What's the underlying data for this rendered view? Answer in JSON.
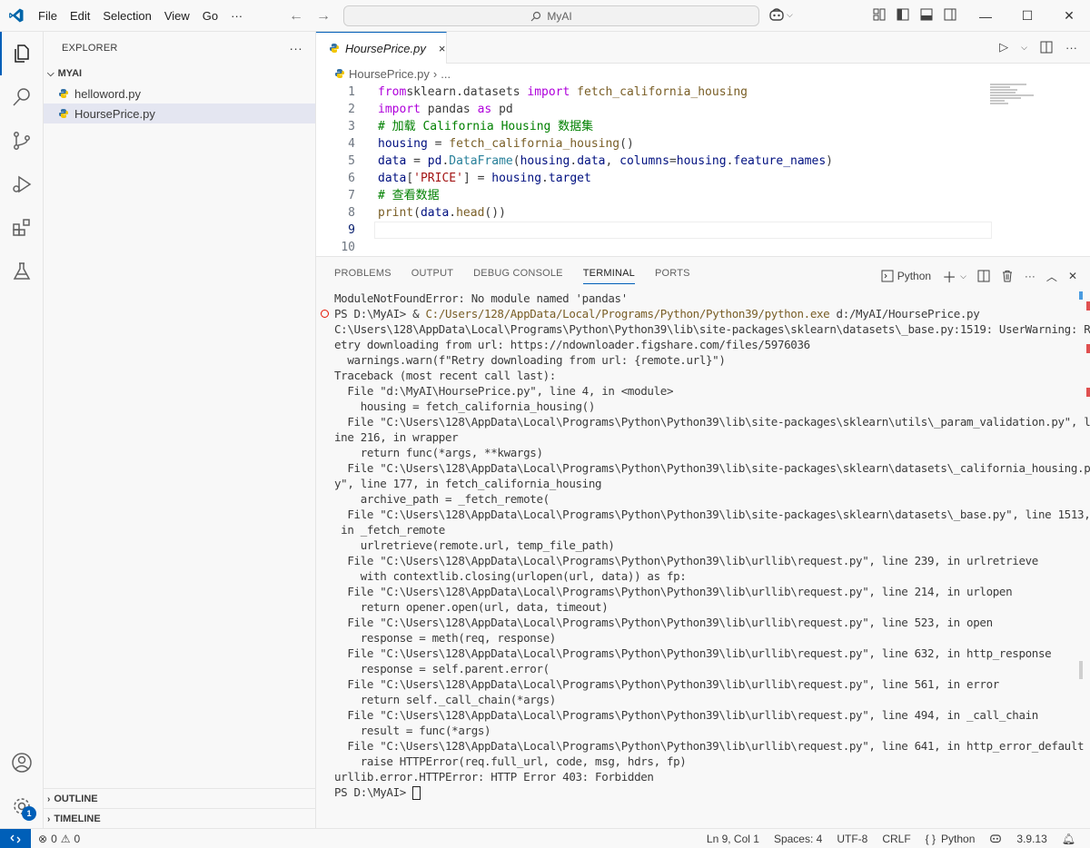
{
  "titlebar": {
    "menus": [
      "File",
      "Edit",
      "Selection",
      "View",
      "Go",
      "···"
    ],
    "search": "MyAI"
  },
  "sidebar": {
    "title": "EXPLORER",
    "more": "···",
    "folder": "MYAI",
    "files": [
      {
        "name": "helloword.py",
        "selected": false
      },
      {
        "name": "HoursePrice.py",
        "selected": true
      }
    ],
    "outline": "OUTLINE",
    "timeline": "TIMELINE"
  },
  "tabs": [
    {
      "label": "HoursePrice.py",
      "close": "×"
    }
  ],
  "breadcrumb": {
    "file": "HoursePrice.py",
    "rest": "..."
  },
  "editor": {
    "current_line": 9,
    "lines": [
      {
        "n": "1",
        "segments": [
          [
            "kw",
            "from"
          ],
          [
            "",
            "sklearn.datasets "
          ],
          [
            "kw",
            "import"
          ],
          [
            "",
            " "
          ],
          [
            "fn",
            "fetch_california_housing"
          ]
        ]
      },
      {
        "n": "2",
        "segments": [
          [
            "kw",
            "import"
          ],
          [
            "",
            " pandas "
          ],
          [
            "kw",
            "as"
          ],
          [
            "",
            " pd"
          ]
        ]
      },
      {
        "n": "3",
        "segments": [
          [
            "cmt",
            "# 加载 California Housing 数据集"
          ]
        ]
      },
      {
        "n": "4",
        "segments": [
          [
            "var",
            "housing"
          ],
          [
            "",
            " = "
          ],
          [
            "fn",
            "fetch_california_housing"
          ],
          [
            "",
            "()"
          ]
        ]
      },
      {
        "n": "5",
        "segments": [
          [
            "var",
            "data"
          ],
          [
            "",
            " = "
          ],
          [
            "var",
            "pd"
          ],
          [
            "",
            "."
          ],
          [
            "cls",
            "DataFrame"
          ],
          [
            "",
            "("
          ],
          [
            "var",
            "housing"
          ],
          [
            "",
            "."
          ],
          [
            "var",
            "data"
          ],
          [
            "",
            ", "
          ],
          [
            "var",
            "columns"
          ],
          [
            "",
            "="
          ],
          [
            "var",
            "housing"
          ],
          [
            "",
            "."
          ],
          [
            "var",
            "feature_names"
          ],
          [
            "",
            ")"
          ]
        ]
      },
      {
        "n": "6",
        "segments": [
          [
            "var",
            "data"
          ],
          [
            "",
            "["
          ],
          [
            "str",
            "'PRICE'"
          ],
          [
            "",
            "] = "
          ],
          [
            "var",
            "housing"
          ],
          [
            "",
            "."
          ],
          [
            "var",
            "target"
          ]
        ]
      },
      {
        "n": "7",
        "segments": [
          [
            "cmt",
            "# 查看数据"
          ]
        ]
      },
      {
        "n": "8",
        "segments": [
          [
            "fn",
            "print"
          ],
          [
            "",
            "("
          ],
          [
            "var",
            "data"
          ],
          [
            "",
            "."
          ],
          [
            "fn",
            "head"
          ],
          [
            "",
            "())"
          ]
        ]
      },
      {
        "n": "9",
        "segments": []
      },
      {
        "n": "10",
        "segments": []
      }
    ]
  },
  "panel": {
    "tabs": [
      "PROBLEMS",
      "OUTPUT",
      "DEBUG CONSOLE",
      "TERMINAL",
      "PORTS"
    ],
    "active_tab": "TERMINAL",
    "shell_label": "Python",
    "terminal": {
      "first": "ModuleNotFoundError: No module named 'pandas'",
      "prompt_cmd": "PS D:\\MyAI> & ",
      "exe": "C:/Users/128/AppData/Local/Programs/Python/Python39/python.exe",
      "arg": " d:/MyAI/HoursePrice.py",
      "lines": [
        "C:\\Users\\128\\AppData\\Local\\Programs\\Python\\Python39\\lib\\site-packages\\sklearn\\datasets\\_base.py:1519: UserWarning: R",
        "etry downloading from url: https://ndownloader.figshare.com/files/5976036",
        "  warnings.warn(f\"Retry downloading from url: {remote.url}\")",
        "Traceback (most recent call last):",
        "  File \"d:\\MyAI\\HoursePrice.py\", line 4, in <module>",
        "    housing = fetch_california_housing()",
        "  File \"C:\\Users\\128\\AppData\\Local\\Programs\\Python\\Python39\\lib\\site-packages\\sklearn\\utils\\_param_validation.py\", l",
        "ine 216, in wrapper",
        "    return func(*args, **kwargs)",
        "  File \"C:\\Users\\128\\AppData\\Local\\Programs\\Python\\Python39\\lib\\site-packages\\sklearn\\datasets\\_california_housing.p",
        "y\", line 177, in fetch_california_housing",
        "    archive_path = _fetch_remote(",
        "  File \"C:\\Users\\128\\AppData\\Local\\Programs\\Python\\Python39\\lib\\site-packages\\sklearn\\datasets\\_base.py\", line 1513,",
        " in _fetch_remote",
        "    urlretrieve(remote.url, temp_file_path)",
        "  File \"C:\\Users\\128\\AppData\\Local\\Programs\\Python\\Python39\\lib\\urllib\\request.py\", line 239, in urlretrieve",
        "    with contextlib.closing(urlopen(url, data)) as fp:",
        "  File \"C:\\Users\\128\\AppData\\Local\\Programs\\Python\\Python39\\lib\\urllib\\request.py\", line 214, in urlopen",
        "    return opener.open(url, data, timeout)",
        "  File \"C:\\Users\\128\\AppData\\Local\\Programs\\Python\\Python39\\lib\\urllib\\request.py\", line 523, in open",
        "    response = meth(req, response)",
        "  File \"C:\\Users\\128\\AppData\\Local\\Programs\\Python\\Python39\\lib\\urllib\\request.py\", line 632, in http_response",
        "    response = self.parent.error(",
        "  File \"C:\\Users\\128\\AppData\\Local\\Programs\\Python\\Python39\\lib\\urllib\\request.py\", line 561, in error",
        "    return self._call_chain(*args)",
        "  File \"C:\\Users\\128\\AppData\\Local\\Programs\\Python\\Python39\\lib\\urllib\\request.py\", line 494, in _call_chain",
        "    result = func(*args)",
        "  File \"C:\\Users\\128\\AppData\\Local\\Programs\\Python\\Python39\\lib\\urllib\\request.py\", line 641, in http_error_default",
        "    raise HTTPError(req.full_url, code, msg, hdrs, fp)",
        "urllib.error.HTTPError: HTTP Error 403: Forbidden"
      ],
      "final_prompt": "PS D:\\MyAI> "
    }
  },
  "statusbar": {
    "errors": "0",
    "warnings": "0",
    "position": "Ln 9, Col 1",
    "spaces": "Spaces: 4",
    "encoding": "UTF-8",
    "eol": "CRLF",
    "language": "Python",
    "version": "3.9.13"
  },
  "accounts_badge": "1",
  "colors": {
    "accent": "#005fb8",
    "error": "#e51400"
  }
}
